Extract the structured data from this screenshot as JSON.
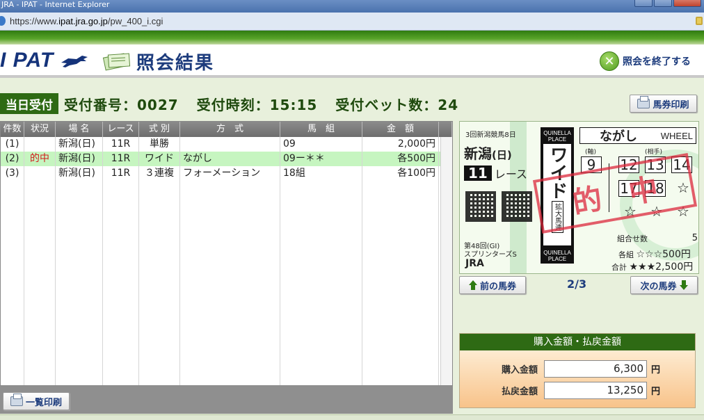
{
  "window": {
    "title": "JRA - IPAT - Internet Explorer"
  },
  "address": {
    "host_prefix": "https://www.",
    "host_bold": "ipat.jra.go.jp",
    "path": "/pw_400_i.cgi"
  },
  "header": {
    "logo": "I PAT",
    "logo_sub": "アイパット",
    "title": "照会結果",
    "end_label": "照会を終了する"
  },
  "receipt": {
    "tag": "当日受付",
    "number": "受付番号：0027",
    "time": "受付時刻：15:15",
    "bet_count": "受付ベット数：24"
  },
  "buttons": {
    "ticket_print": "馬券印刷",
    "list_print": "一覧印刷",
    "prev": "前の馬券",
    "next": "次の馬券"
  },
  "table": {
    "headers": [
      "件数",
      "状況",
      "場 名",
      "レース",
      "式 別",
      "方　式",
      "馬　組",
      "金　額"
    ],
    "rows": [
      {
        "no": "(1)",
        "status": "",
        "venue": "新潟(日)",
        "race": "11R",
        "type": "単勝",
        "method": "",
        "combo": "09",
        "amount": "2,000円"
      },
      {
        "no": "(2)",
        "status": "的中",
        "venue": "新潟(日)",
        "race": "11R",
        "type": "ワイド",
        "method": "ながし",
        "combo": "09ー＊＊",
        "amount": "各500円"
      },
      {
        "no": "(3)",
        "status": "",
        "venue": "新潟(日)",
        "race": "11R",
        "type": "３連複",
        "method": "フォーメーション",
        "combo": "18組",
        "amount": "各100円"
      }
    ]
  },
  "ticket": {
    "meeting": "3回新潟競馬8日",
    "venue": "新潟",
    "day": "(日)",
    "race_no": "11",
    "race_label": "レース",
    "event_line1": "第48回(GI)",
    "event_line2": "スプリンターズS",
    "jra": "JRA",
    "band_top": "QUINELLA PLACE",
    "band_bottom": "QUINELLA PLACE",
    "bet_type": "ワイド",
    "bet_type_sub": "拡大馬連",
    "method": "ながし",
    "method_en": "WHEEL",
    "axis_label": "(軸)",
    "partner_label": "(相手)",
    "axis": "9",
    "partners": [
      "12",
      "13",
      "14",
      "17",
      "18"
    ],
    "stars": [
      "☆",
      "☆",
      "☆",
      "☆"
    ],
    "stamp": "的中",
    "combos_label": "組合せ数",
    "combos": "5",
    "each_label": "各組",
    "each_value": "☆☆☆500円",
    "total_label": "合計",
    "total_value": "★★★2,500円"
  },
  "pager": "2/3",
  "summary": {
    "title": "購入金額・払戻金額",
    "purchase_label": "購入金額",
    "purchase_value": "6,300",
    "payout_label": "払戻金額",
    "payout_value": "13,250",
    "unit": "円"
  },
  "colors": {
    "accent_green": "#2e6a14",
    "hit_row": "#c6f5c0",
    "hit_text": "#d21c1c"
  }
}
